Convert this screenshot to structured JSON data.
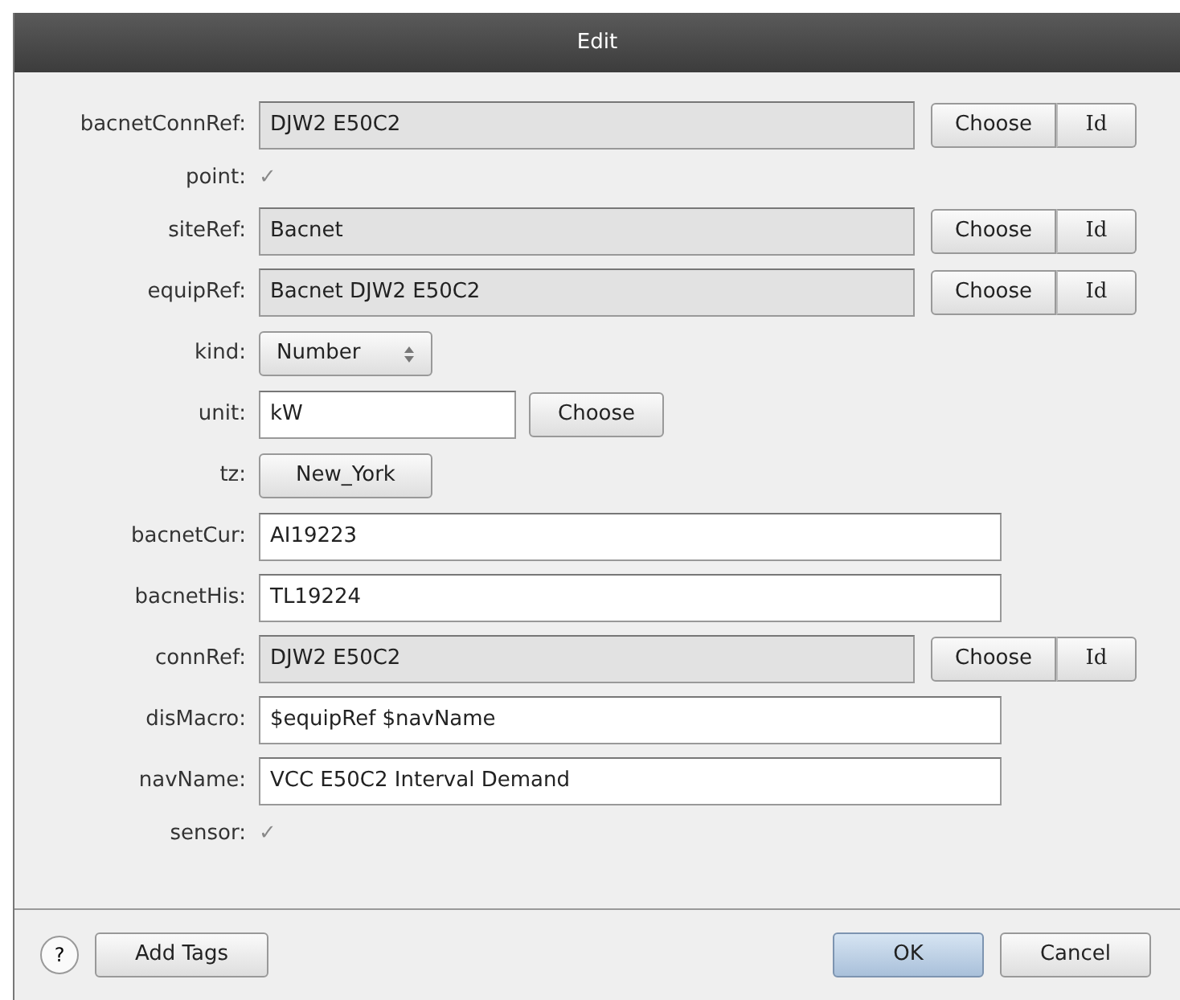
{
  "window": {
    "title": "Edit"
  },
  "fields": [
    {
      "kind": "ref",
      "label": "bacnetConnRef:",
      "value": "DJW2 E50C2",
      "choose": "Choose",
      "id": "Id"
    },
    {
      "kind": "check",
      "label": "point:",
      "mark": "✓"
    },
    {
      "kind": "ref",
      "label": "siteRef:",
      "value": "Bacnet",
      "choose": "Choose",
      "id": "Id"
    },
    {
      "kind": "ref",
      "label": "equipRef:",
      "value": "Bacnet DJW2 E50C2",
      "choose": "Choose",
      "id": "Id"
    },
    {
      "kind": "select",
      "label": "kind:",
      "value": "Number"
    },
    {
      "kind": "textchoose",
      "label": "unit:",
      "value": "kW",
      "choose": "Choose"
    },
    {
      "kind": "button",
      "label": "tz:",
      "value": "New_York"
    },
    {
      "kind": "text",
      "label": "bacnetCur:",
      "value": "AI19223"
    },
    {
      "kind": "text",
      "label": "bacnetHis:",
      "value": "TL19224"
    },
    {
      "kind": "ref",
      "label": "connRef:",
      "value": "DJW2 E50C2",
      "choose": "Choose",
      "id": "Id"
    },
    {
      "kind": "text",
      "label": "disMacro:",
      "value": "$equipRef $navName"
    },
    {
      "kind": "text",
      "label": "navName:",
      "value": "VCC E50C2 Interval Demand"
    },
    {
      "kind": "check",
      "label": "sensor:",
      "mark": "✓"
    }
  ],
  "footer": {
    "help": "?",
    "add_tags": "Add Tags",
    "ok": "OK",
    "cancel": "Cancel"
  }
}
